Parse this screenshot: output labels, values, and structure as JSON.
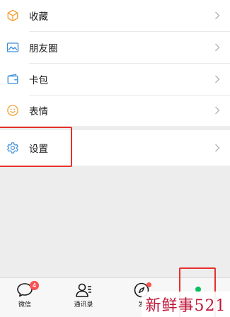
{
  "menu": {
    "items": [
      {
        "label": "收藏",
        "icon": "box-icon"
      },
      {
        "label": "朋友圈",
        "icon": "image-icon"
      },
      {
        "label": "卡包",
        "icon": "wallet-icon"
      },
      {
        "label": "表情",
        "icon": "smiley-icon"
      }
    ],
    "settings": {
      "label": "设置",
      "icon": "gear-icon"
    }
  },
  "tabbar": {
    "tabs": [
      {
        "label": "微信",
        "icon": "chat-icon",
        "badge": "4"
      },
      {
        "label": "通讯录",
        "icon": "contacts-icon"
      },
      {
        "label": "发",
        "icon": "compass-icon"
      },
      {
        "label": "",
        "icon": "me-icon"
      }
    ]
  },
  "watermark": {
    "text": "新鲜事521"
  },
  "colors": {
    "highlight": "#e8302c",
    "badge": "#fa5151",
    "active_green": "#07c160",
    "watermark": "#c0173a"
  }
}
